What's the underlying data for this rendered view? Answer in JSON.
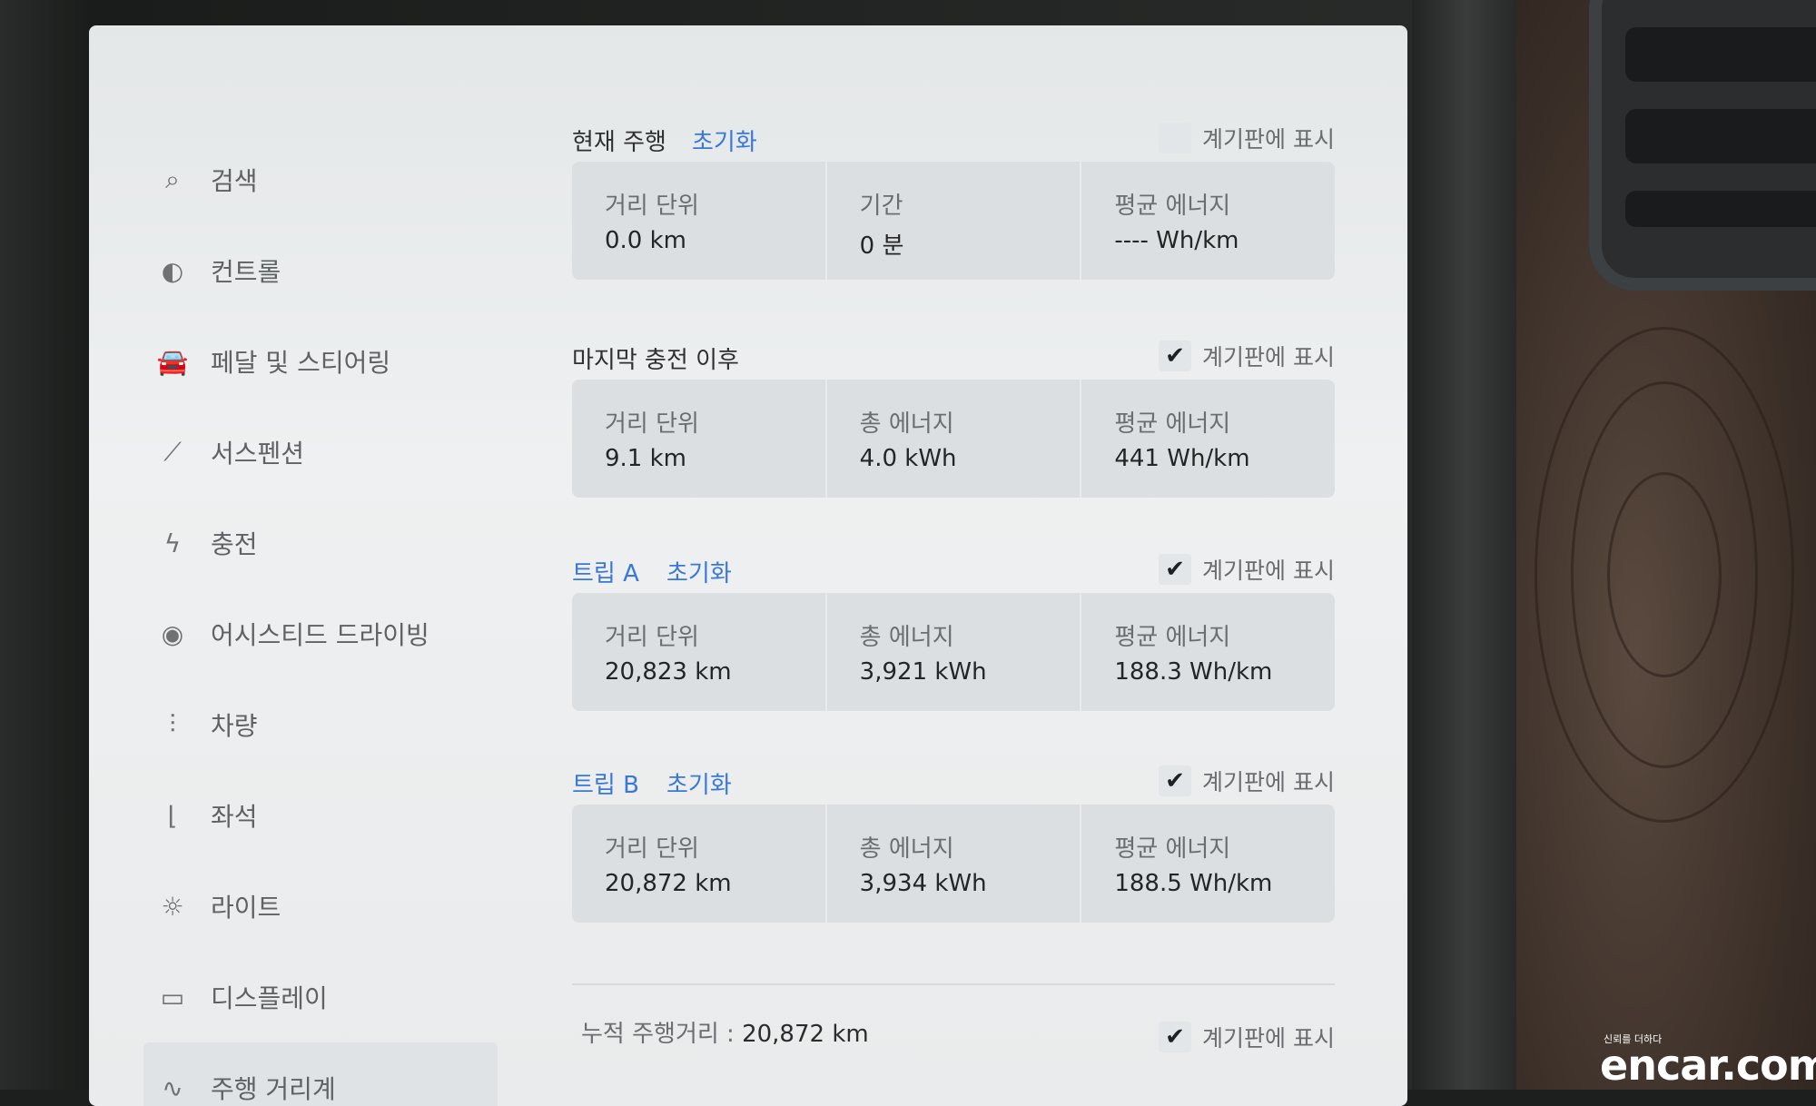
{
  "sidebar": {
    "items": [
      {
        "label": "검색",
        "icon": "search-icon",
        "glyph": "⌕"
      },
      {
        "label": "컨트롤",
        "icon": "toggle-icon",
        "glyph": "◐"
      },
      {
        "label": "페달 및 스티어링",
        "icon": "car-icon",
        "glyph": "🚘"
      },
      {
        "label": "서스펜션",
        "icon": "suspension-icon",
        "glyph": "⟋"
      },
      {
        "label": "충전",
        "icon": "bolt-icon",
        "glyph": "ϟ"
      },
      {
        "label": "어시스티드 드라이빙",
        "icon": "steering-wheel-icon",
        "glyph": "◉"
      },
      {
        "label": "차량",
        "icon": "sliders-icon",
        "glyph": "⫶"
      },
      {
        "label": "좌석",
        "icon": "seat-icon",
        "glyph": "⌊"
      },
      {
        "label": "라이트",
        "icon": "sun-icon",
        "glyph": "☼"
      },
      {
        "label": "디스플레이",
        "icon": "display-icon",
        "glyph": "▭"
      },
      {
        "label": "주행 거리계",
        "icon": "trip-icon",
        "glyph": "∿"
      }
    ]
  },
  "dash_label": "계기판에 표시",
  "check_glyph": "✔",
  "current_drive": {
    "title": "현재 주행",
    "reset": "초기화",
    "checked": false,
    "stats": [
      {
        "label": "거리 단위",
        "value": "0.0  km"
      },
      {
        "label": "기간",
        "value": "0 분"
      },
      {
        "label": "평균 에너지",
        "value": "----  Wh/km"
      }
    ]
  },
  "since_charge": {
    "title": "마지막 충전 이후",
    "checked": true,
    "stats": [
      {
        "label": "거리 단위",
        "value": "9.1  km"
      },
      {
        "label": "총 에너지",
        "value": "4.0  kWh"
      },
      {
        "label": "평균 에너지",
        "value": "441  Wh/km"
      }
    ]
  },
  "trip_a": {
    "title": "트립 A",
    "reset": "초기화",
    "checked": true,
    "stats": [
      {
        "label": "거리 단위",
        "value": "20,823  km"
      },
      {
        "label": "총 에너지",
        "value": "3,921  kWh"
      },
      {
        "label": "평균 에너지",
        "value": "188.3  Wh/km"
      }
    ]
  },
  "trip_b": {
    "title": "트립 B",
    "reset": "초기화",
    "checked": true,
    "stats": [
      {
        "label": "거리 단위",
        "value": "20,872  km"
      },
      {
        "label": "총 에너지",
        "value": "3,934  kWh"
      },
      {
        "label": "평균 에너지",
        "value": "188.5  Wh/km"
      }
    ]
  },
  "odometer": {
    "label": "누적 주행거리 : ",
    "value": "20,872  km",
    "checked": true
  },
  "watermark": {
    "tag": "신뢰를 더하다",
    "brand": "encar.com"
  }
}
